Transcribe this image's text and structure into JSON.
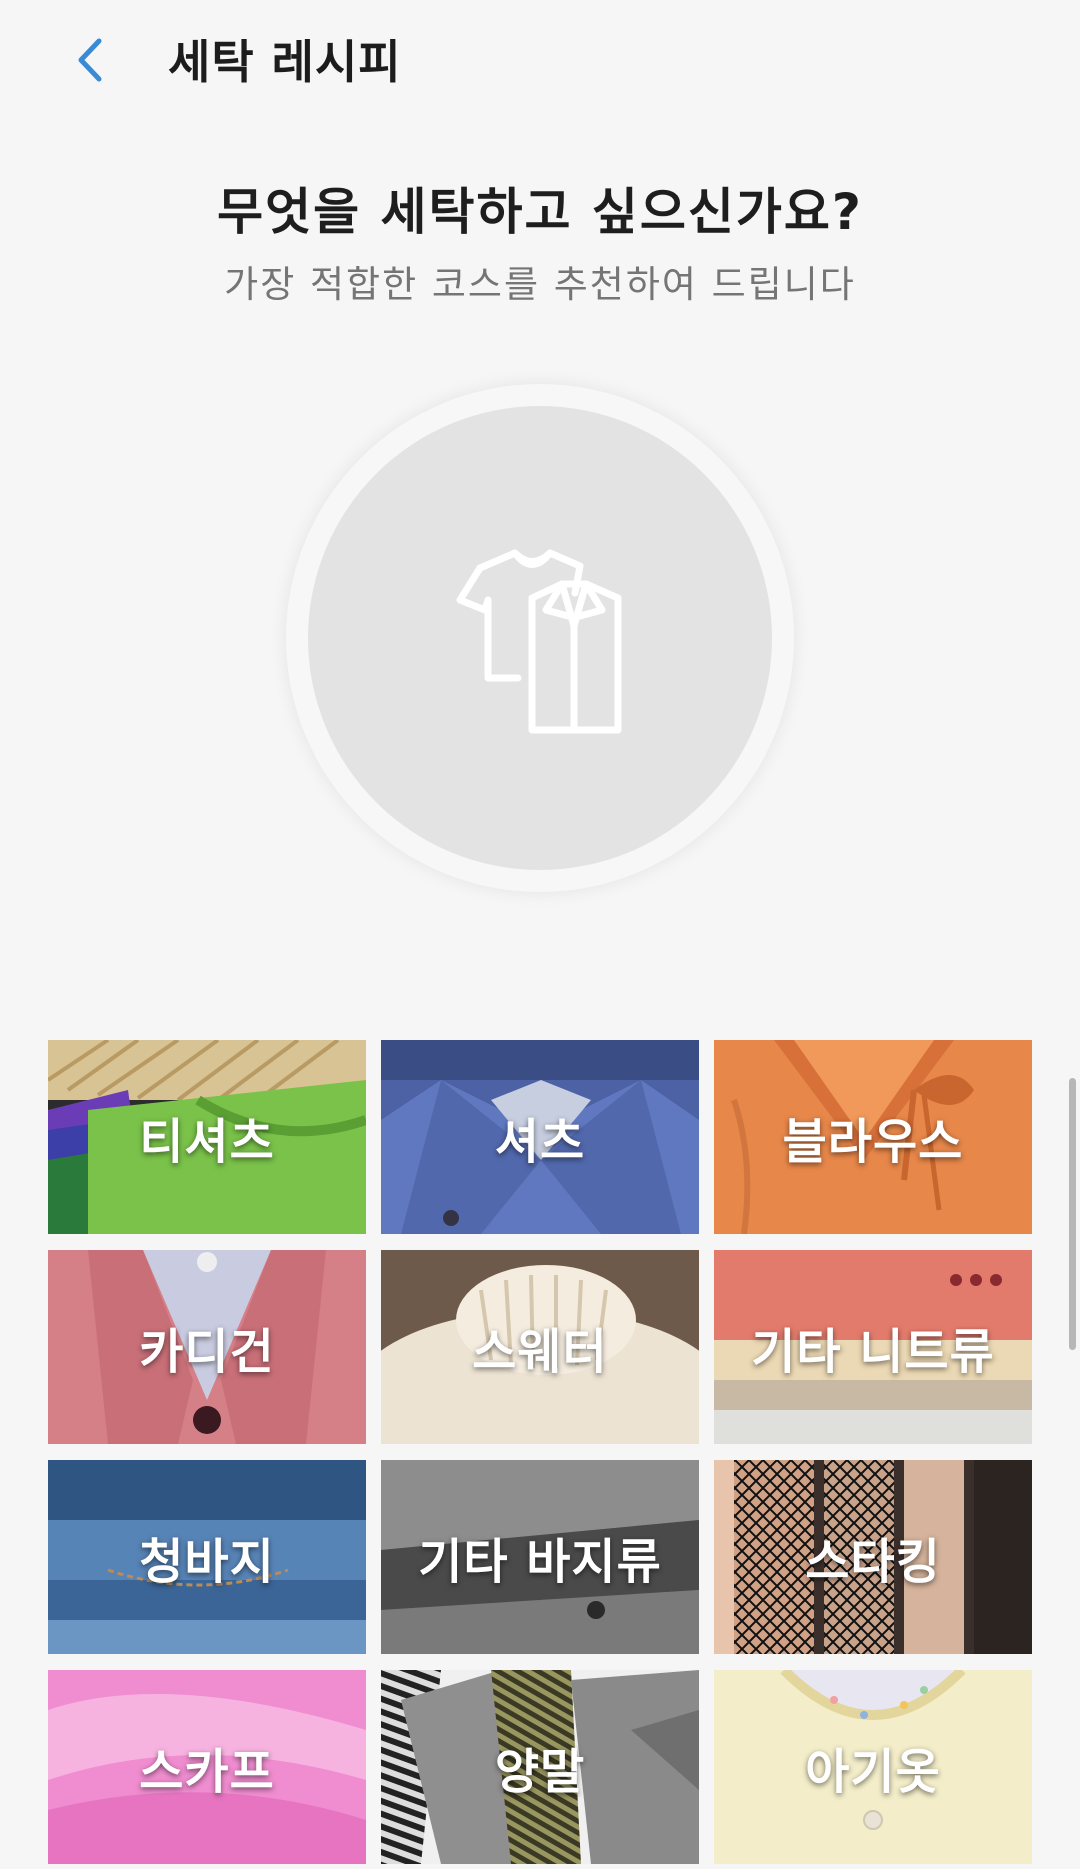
{
  "header": {
    "title": "세탁 레시피",
    "accent_color": "#3a8bd6"
  },
  "intro": {
    "question": "무엇을 세탁하고 싶으신가요?",
    "subtitle": "가장 적합한 코스를 추천하여 드립니다"
  },
  "center_icon": "clothes-icon",
  "categories": [
    {
      "label": "티셔츠"
    },
    {
      "label": "셔츠"
    },
    {
      "label": "블라우스"
    },
    {
      "label": "카디건"
    },
    {
      "label": "스웨터"
    },
    {
      "label": "기타 니트류"
    },
    {
      "label": "청바지"
    },
    {
      "label": "기타 바지류"
    },
    {
      "label": "스타킹"
    },
    {
      "label": "스카프"
    },
    {
      "label": "양말"
    },
    {
      "label": "아기옷"
    }
  ]
}
